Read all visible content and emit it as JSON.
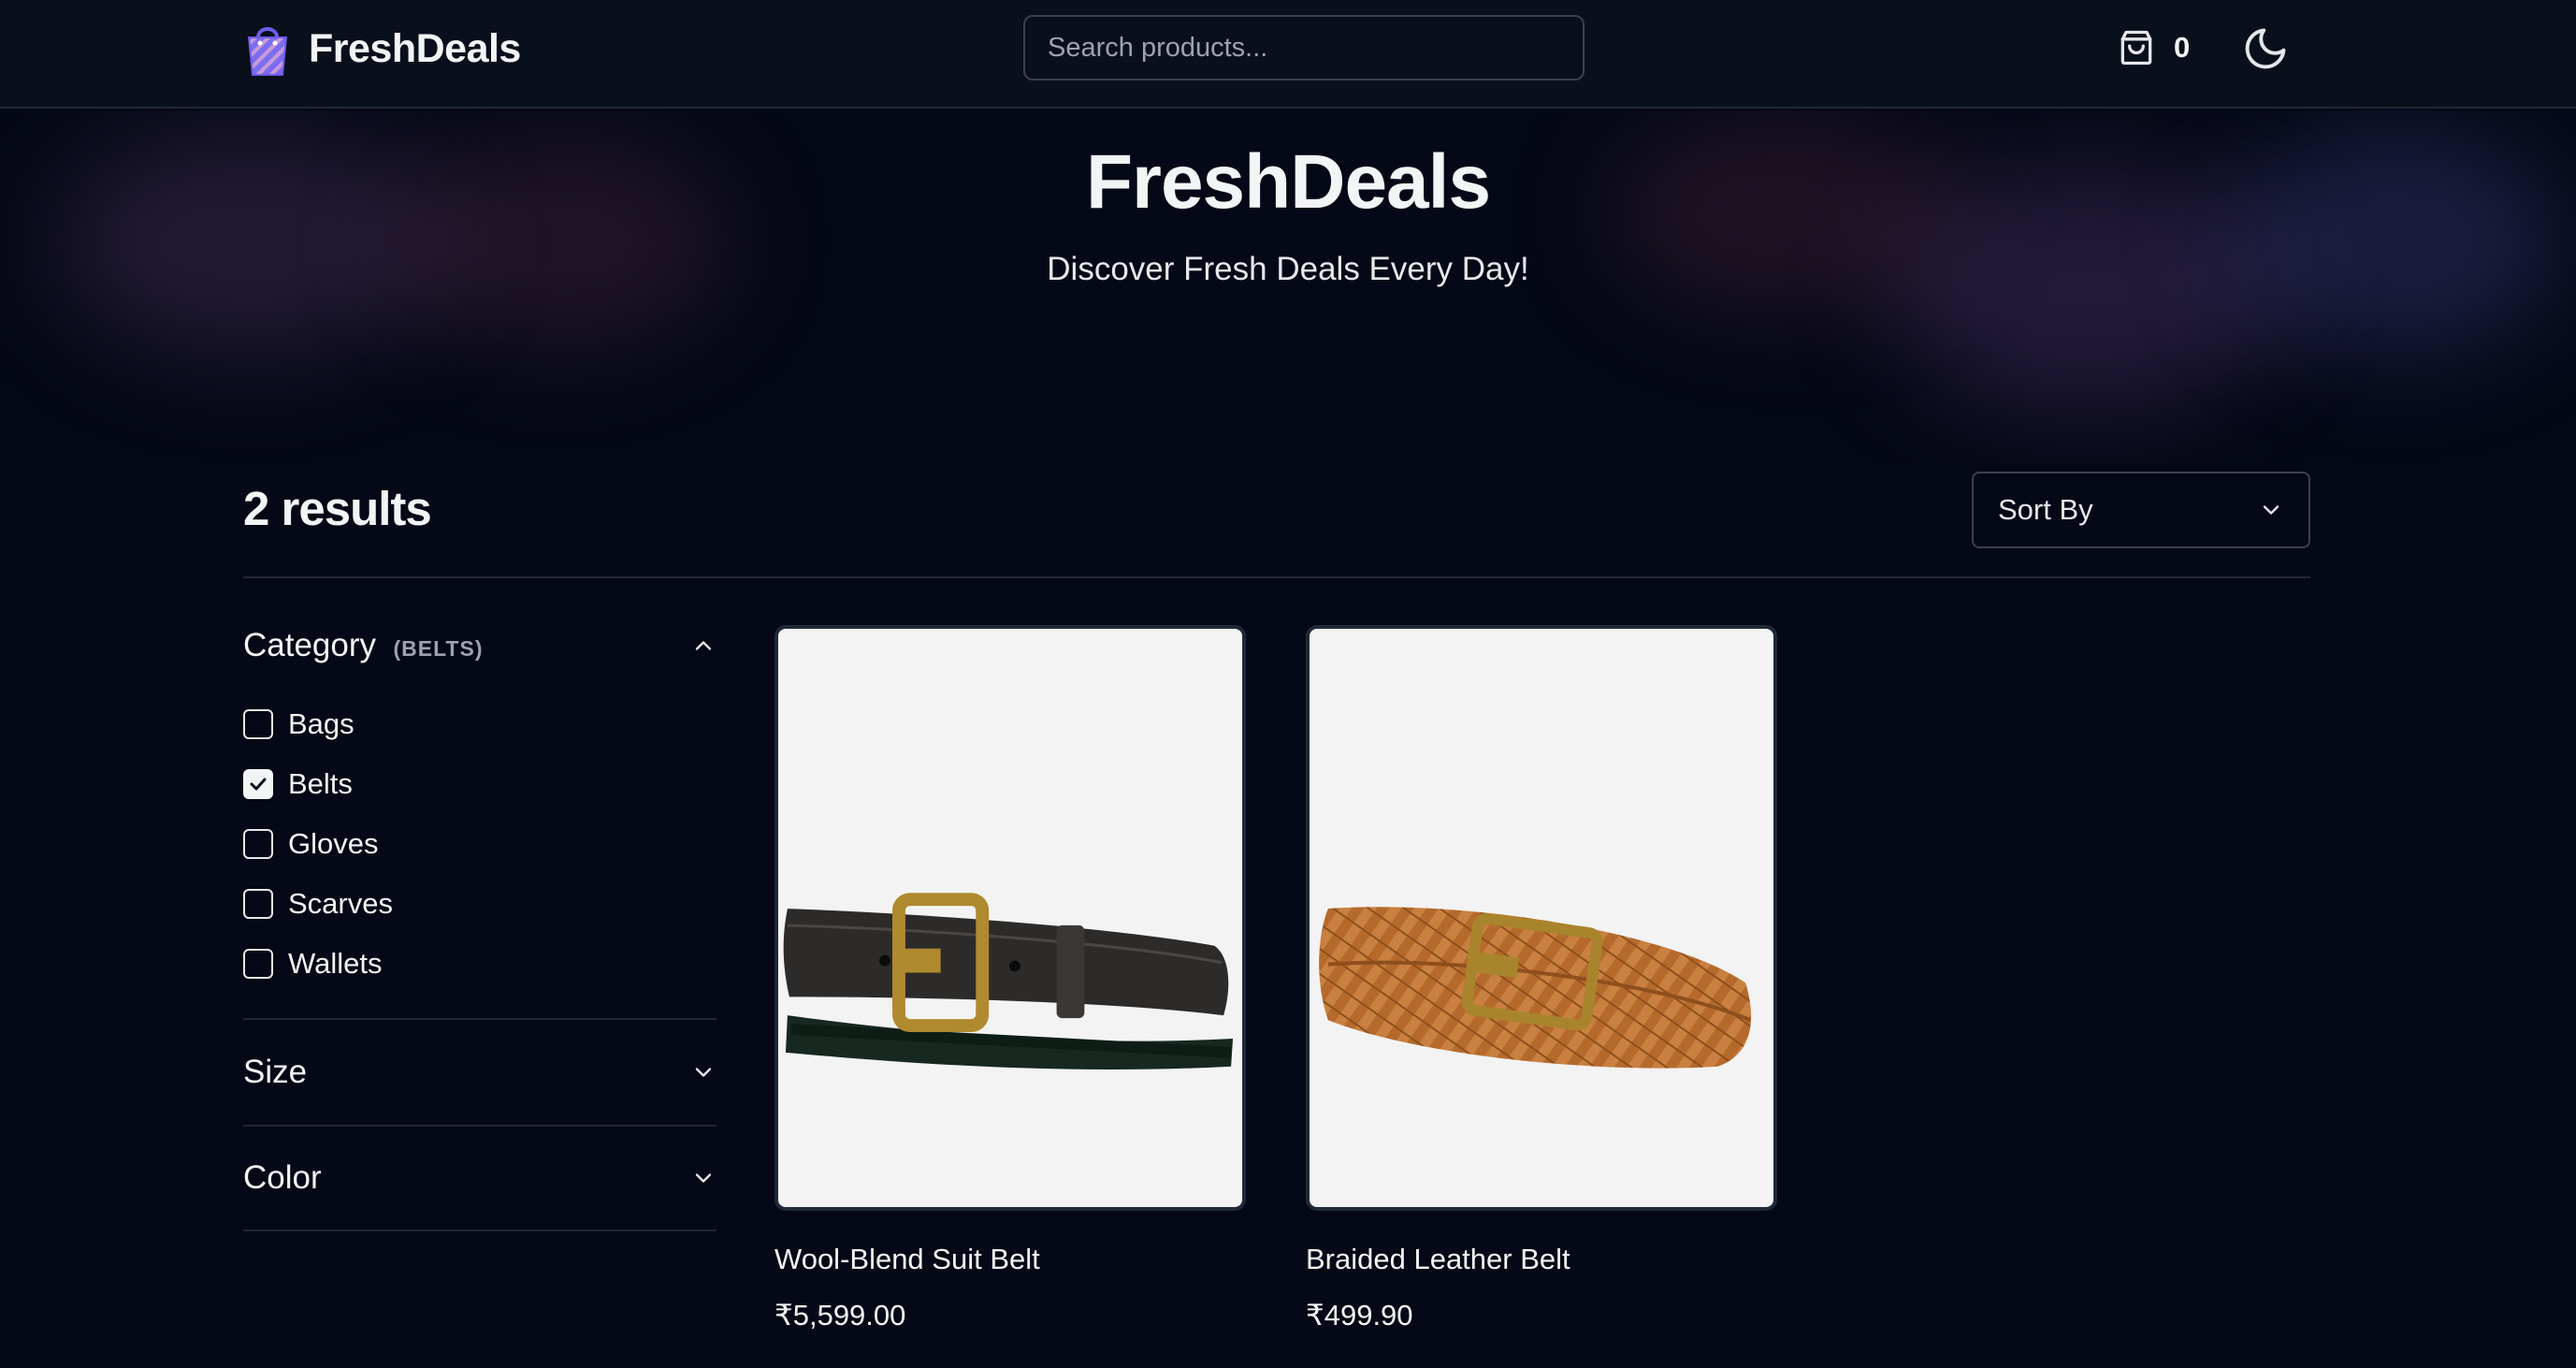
{
  "header": {
    "brand": "FreshDeals",
    "search_placeholder": "Search products...",
    "cart_count": "0",
    "icons": {
      "logo": "shopping-bag-logo",
      "cart": "cart-bag-icon",
      "theme": "moon-icon"
    }
  },
  "hero": {
    "title": "FreshDeals",
    "subtitle": "Discover Fresh Deals Every Day!"
  },
  "toolbar": {
    "results": "2 results",
    "sort_label": "Sort By"
  },
  "filters": {
    "category": {
      "title": "Category",
      "selected_hint": "(BELTS)",
      "expanded": true,
      "options": [
        {
          "label": "Bags",
          "checked": false
        },
        {
          "label": "Belts",
          "checked": true
        },
        {
          "label": "Gloves",
          "checked": false
        },
        {
          "label": "Scarves",
          "checked": false
        },
        {
          "label": "Wallets",
          "checked": false
        }
      ]
    },
    "size": {
      "title": "Size",
      "expanded": false
    },
    "color": {
      "title": "Color",
      "expanded": false
    }
  },
  "products": [
    {
      "name": "Wool-Blend Suit Belt",
      "price": "₹5,599.00",
      "image": "black-leather-belt-tartan"
    },
    {
      "name": "Braided Leather Belt",
      "price": "₹499.90",
      "image": "tan-braided-leather-belt"
    }
  ],
  "colors": {
    "background": "#050816",
    "topbar": "#0a0f1c",
    "border": "#1f2937",
    "accent": "#8b5cf6"
  }
}
